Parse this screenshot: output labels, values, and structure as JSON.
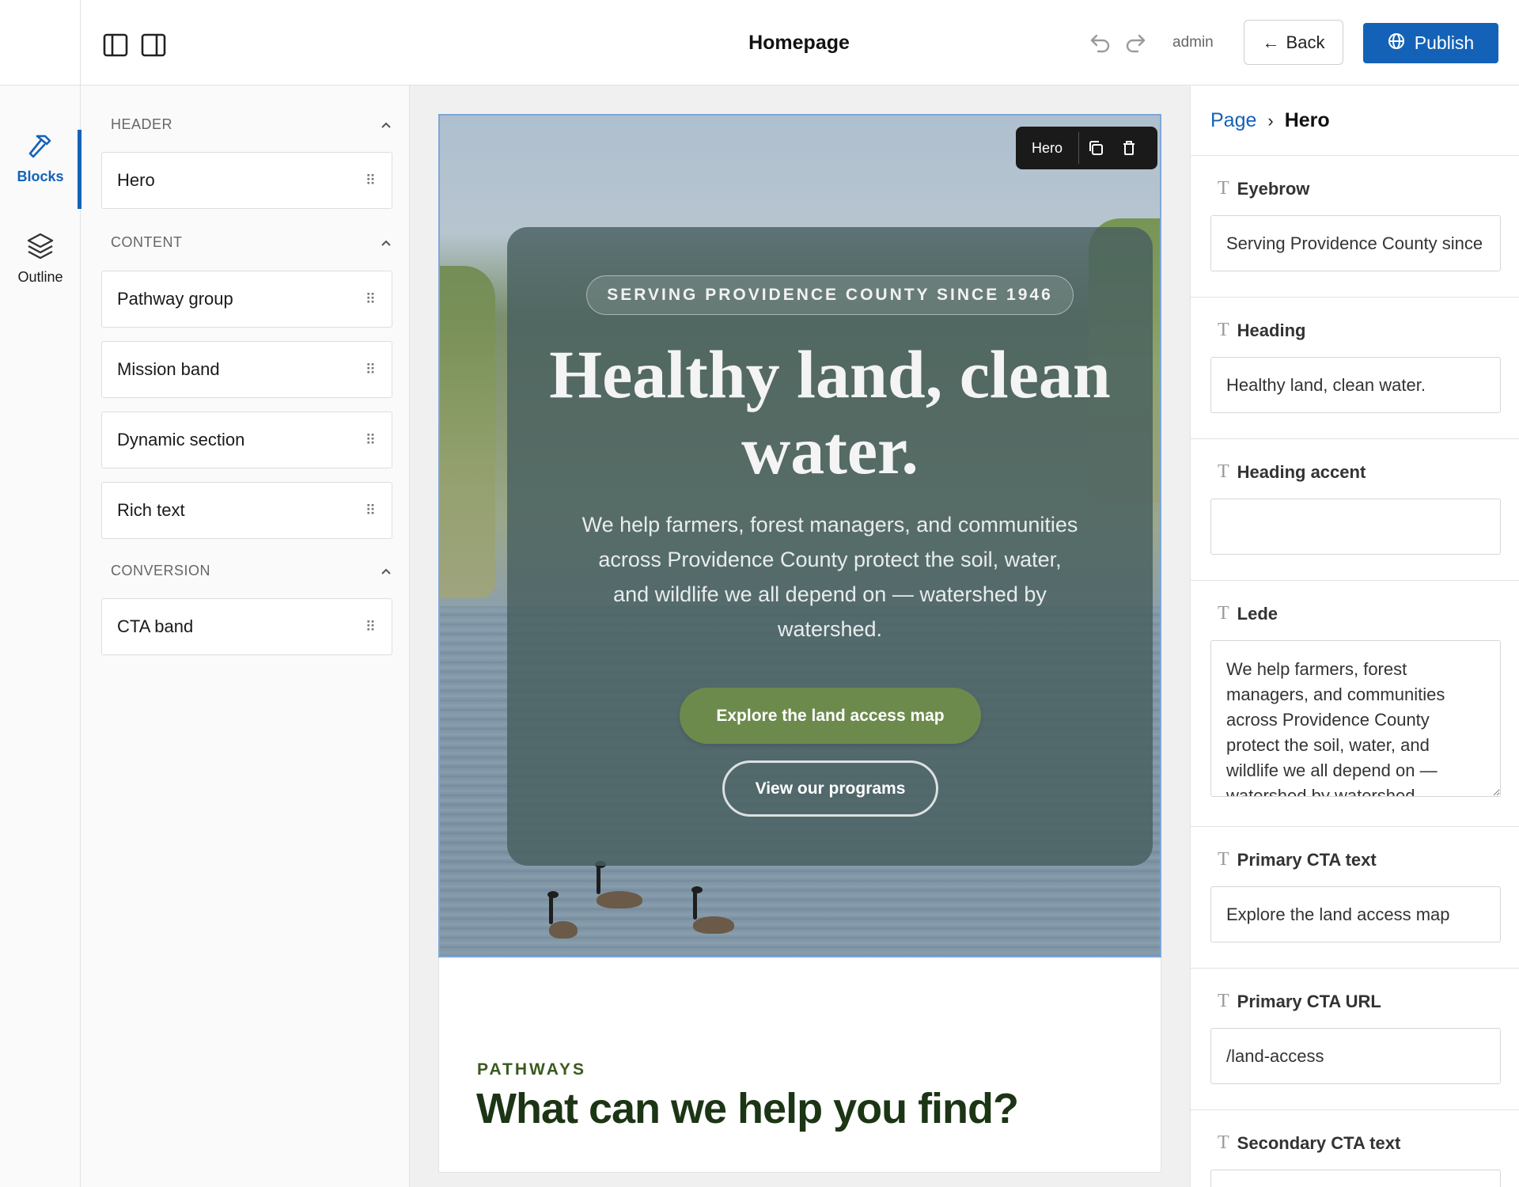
{
  "topbar": {
    "page_title": "Homepage",
    "user": "admin",
    "back_label": "Back",
    "publish_label": "Publish",
    "accent_color": "#1462b8"
  },
  "rail": {
    "items": [
      {
        "label": "Blocks",
        "icon": "hammer-icon",
        "active": true
      },
      {
        "label": "Outline",
        "icon": "layers-icon",
        "active": false
      }
    ]
  },
  "blocks_panel": {
    "groups": [
      {
        "name": "HEADER",
        "blocks": [
          "Hero"
        ]
      },
      {
        "name": "CONTENT",
        "blocks": [
          "Pathway group",
          "Mission band",
          "Dynamic section",
          "Rich text"
        ]
      },
      {
        "name": "CONVERSION",
        "blocks": [
          "CTA band"
        ]
      }
    ]
  },
  "canvas": {
    "hero_toolbar_label": "Hero",
    "hero": {
      "eyebrow": "SERVING PROVIDENCE COUNTY SINCE 1946",
      "heading": "Healthy land, clean water.",
      "lede": "We help farmers, forest managers, and communities across Providence County protect the soil, water, and wildlife we all depend on — watershed by watershed.",
      "primary_cta": "Explore the land access map",
      "secondary_cta": "View our programs",
      "primary_cta_color": "#6d8a4d"
    },
    "pathways": {
      "eyebrow": "PATHWAYS",
      "heading": "What can we help you find?"
    }
  },
  "properties": {
    "breadcrumb": {
      "parent": "Page",
      "current": "Hero"
    },
    "fields": {
      "eyebrow": {
        "label": "Eyebrow",
        "value": "Serving Providence County since 1946"
      },
      "heading": {
        "label": "Heading",
        "value": "Healthy land, clean water."
      },
      "heading_accent": {
        "label": "Heading accent",
        "value": ""
      },
      "lede": {
        "label": "Lede",
        "value": "We help farmers, forest managers, and communities across Providence County protect the soil, water, and wildlife we all depend on — watershed by watershed."
      },
      "primary_cta_text": {
        "label": "Primary CTA text",
        "value": "Explore the land access map"
      },
      "primary_cta_url": {
        "label": "Primary CTA URL",
        "value": "/land-access"
      },
      "secondary_cta_text": {
        "label": "Secondary CTA text",
        "value": "View our programs"
      }
    }
  }
}
